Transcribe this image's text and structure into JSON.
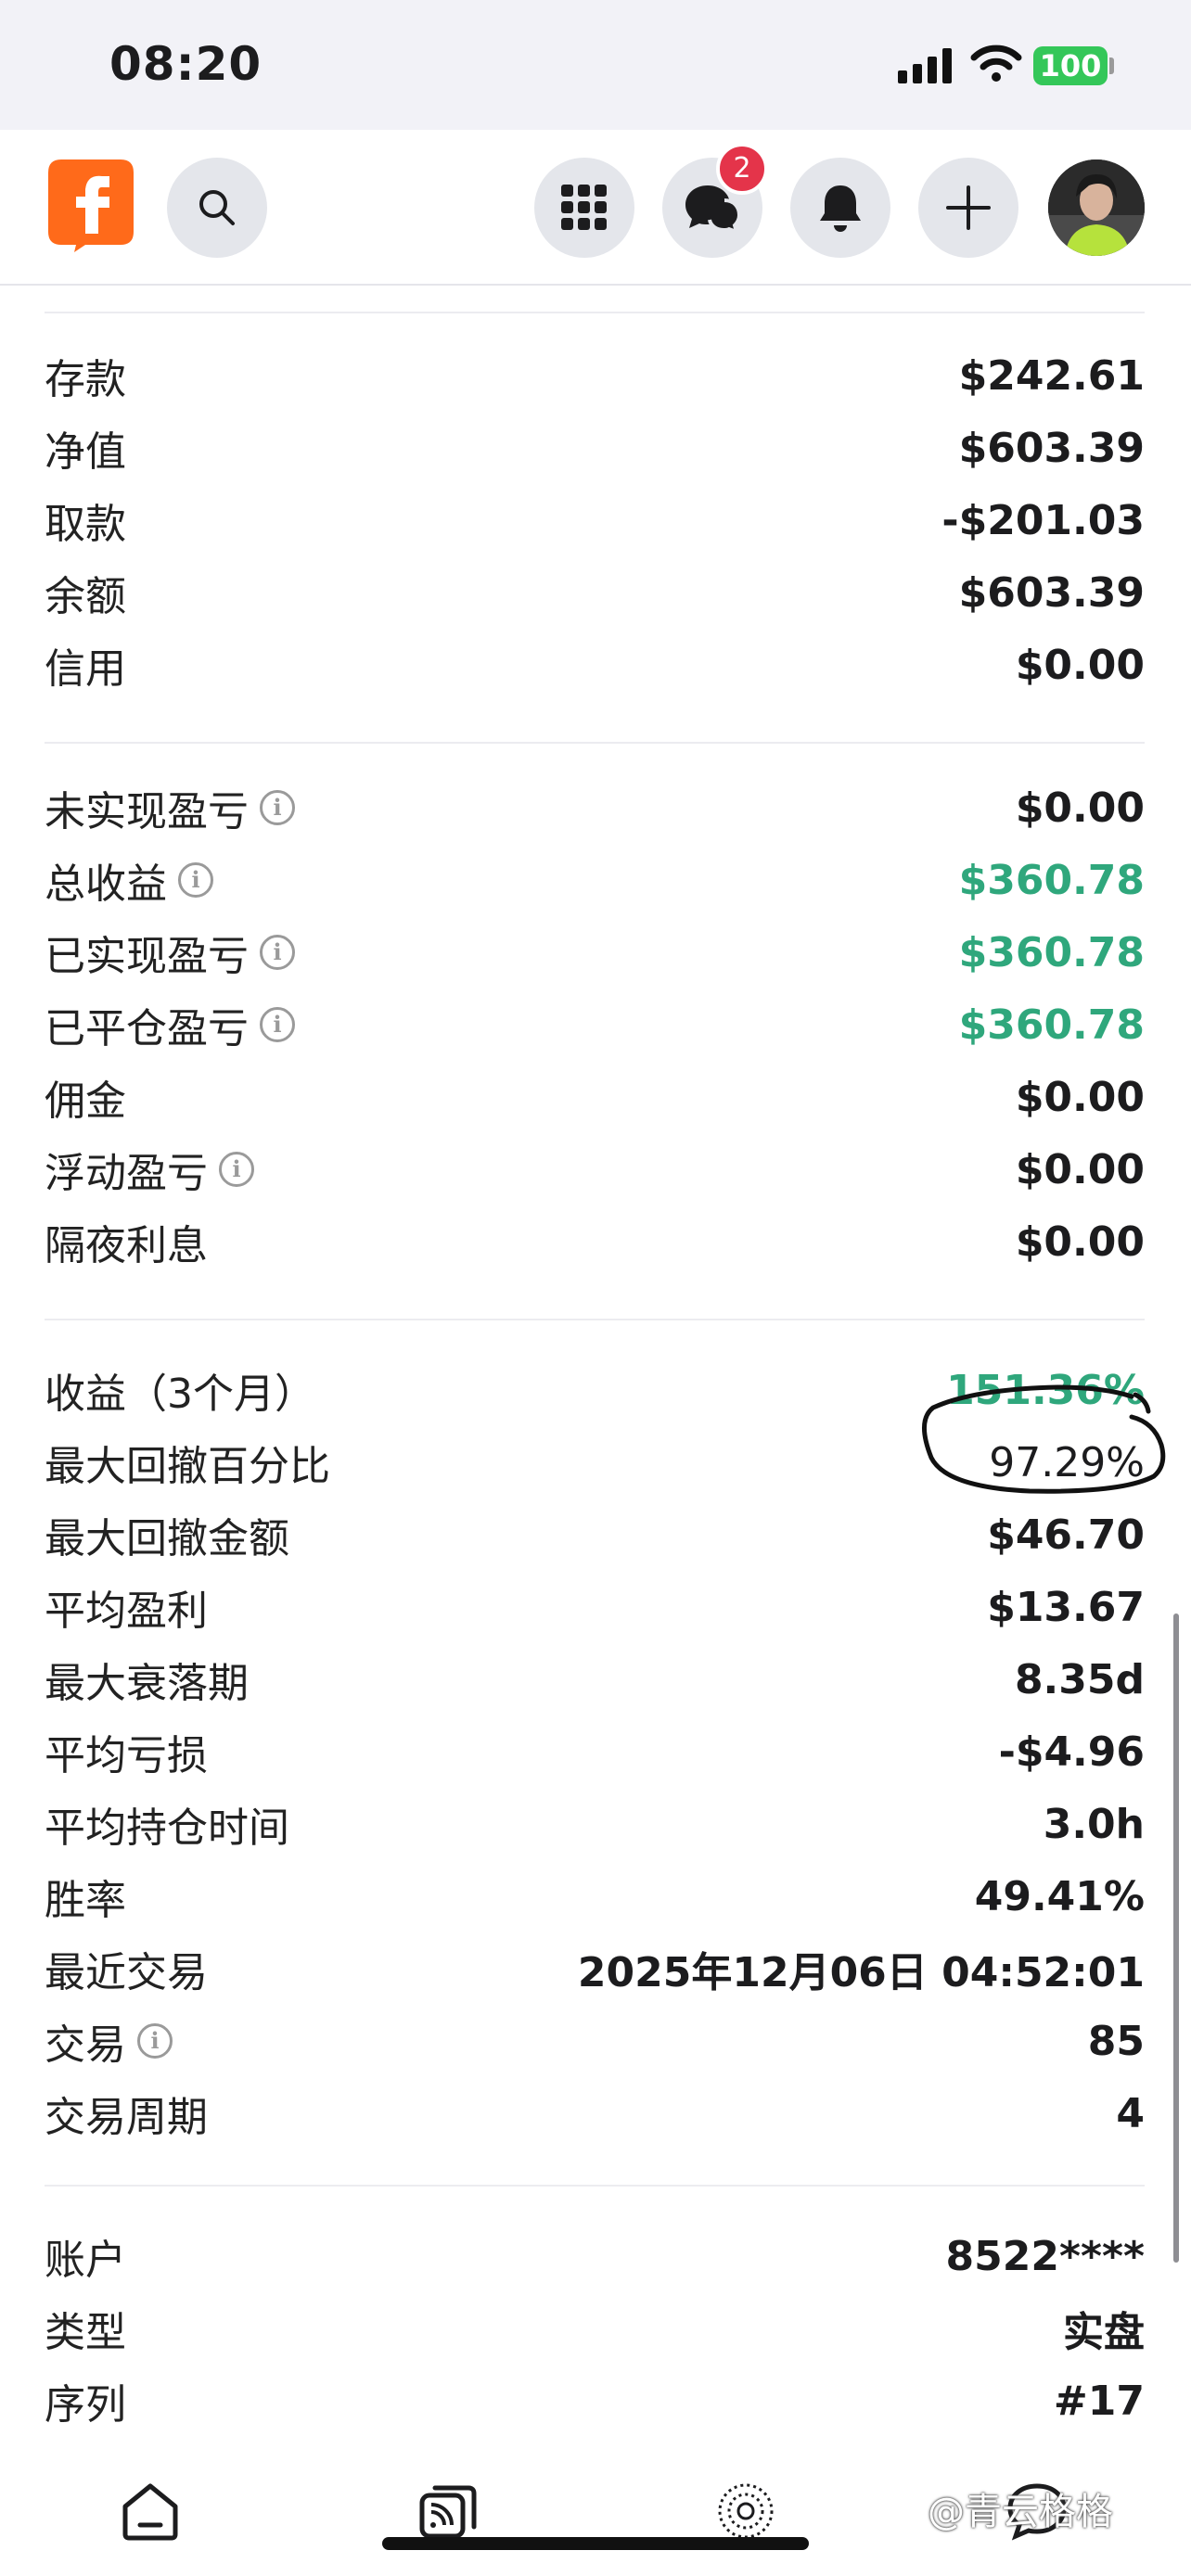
{
  "status_bar": {
    "time": "08:20",
    "battery": "100"
  },
  "topnav": {
    "messages_badge": "2"
  },
  "section_balance": [
    {
      "label": "存款",
      "value": "$242.61"
    },
    {
      "label": "净值",
      "value": "$603.39"
    },
    {
      "label": "取款",
      "value": "-$201.03"
    },
    {
      "label": "余额",
      "value": "$603.39"
    },
    {
      "label": "信用",
      "value": "$0.00"
    }
  ],
  "section_pnl": [
    {
      "label": "未实现盈亏",
      "value": "$0.00",
      "info": true,
      "green": false
    },
    {
      "label": "总收益",
      "value": "$360.78",
      "info": true,
      "green": true
    },
    {
      "label": "已实现盈亏",
      "value": "$360.78",
      "info": true,
      "green": true
    },
    {
      "label": "已平仓盈亏",
      "value": "$360.78",
      "info": true,
      "green": true
    },
    {
      "label": "佣金",
      "value": "$0.00",
      "info": false,
      "green": false
    },
    {
      "label": "浮动盈亏",
      "value": "$0.00",
      "info": true,
      "green": false
    },
    {
      "label": "隔夜利息",
      "value": "$0.00",
      "info": false,
      "green": false
    }
  ],
  "section_stats": [
    {
      "label": "收益（3个月）",
      "value": "151.36%",
      "green": true,
      "info": false
    },
    {
      "label": "最大回撤百分比",
      "value": "97.29%",
      "green": false,
      "info": false
    },
    {
      "label": "最大回撤金额",
      "value": "$46.70",
      "green": false,
      "info": false
    },
    {
      "label": "平均盈利",
      "value": "$13.67",
      "green": false,
      "info": false
    },
    {
      "label": "最大衰落期",
      "value": "8.35d",
      "green": false,
      "info": false
    },
    {
      "label": "平均亏损",
      "value": "-$4.96",
      "green": false,
      "info": false
    },
    {
      "label": "平均持仓时间",
      "value": "3.0h",
      "green": false,
      "info": false
    },
    {
      "label": "胜率",
      "value": "49.41%",
      "green": false,
      "info": false
    },
    {
      "label": "最近交易",
      "value": "2025年12月06日 04:52:01",
      "green": false,
      "info": false
    },
    {
      "label": "交易",
      "value": "85",
      "green": false,
      "info": true
    },
    {
      "label": "交易周期",
      "value": "4",
      "green": false,
      "info": false
    }
  ],
  "section_account": [
    {
      "label": "账户",
      "value": "8522****"
    },
    {
      "label": "类型",
      "value": "实盘"
    },
    {
      "label": "序列",
      "value": "#17"
    }
  ],
  "watermark": "@青云格格",
  "colors": {
    "green": "#2fa77c",
    "brand": "#ff6a1a",
    "badge": "#e4344a"
  }
}
